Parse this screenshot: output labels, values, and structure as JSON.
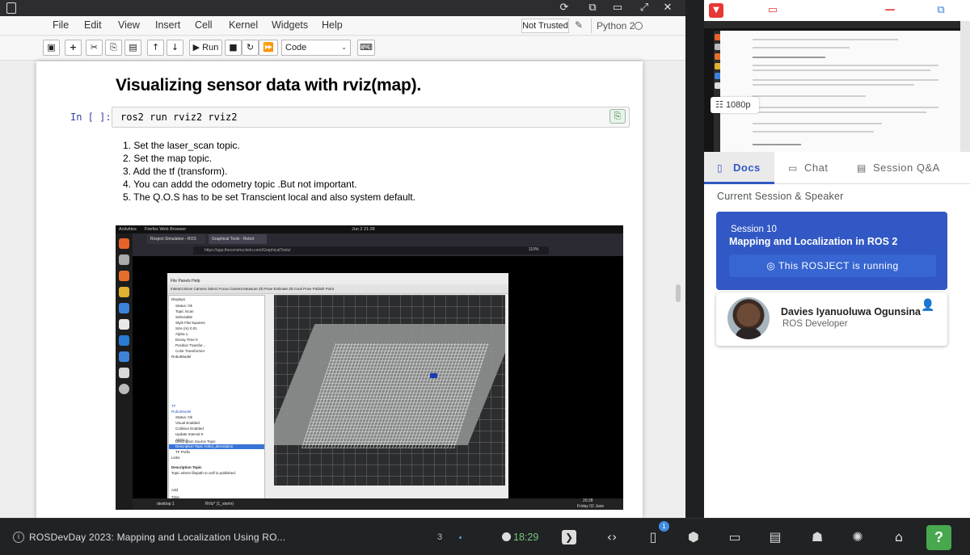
{
  "jupyter": {
    "menu": [
      "File",
      "Edit",
      "View",
      "Insert",
      "Cell",
      "Kernel",
      "Widgets",
      "Help"
    ],
    "trust_label": "Not Trusted",
    "kernel_label": "Python 2",
    "toolbar": {
      "run_label": "Run",
      "cell_type": "Code"
    },
    "heading": "Visualizing sensor data with rviz(map).",
    "prompt": "In [ ]:",
    "code": "ros2 run rviz2 rviz2",
    "steps": [
      "1. Set the laser_scan topic.",
      "2. Set the map topic.",
      "3. Add the tf (transform).",
      "4. You can addd the odometry topic .But not important.",
      "5. The Q.O.S has to be set Transcient local and also system default."
    ]
  },
  "embedded": {
    "activities": "Activities",
    "app_name": "Firefox Web Browser",
    "clock": "Jun 2  21:28",
    "tab1": "Rosject Simulation - ROS",
    "tab2": "Graphical Tools - Robot",
    "url": "https://app.theconstructsim.com/GraphicalTools/",
    "zoom": "110%",
    "rviz_menu": "File   Panels   Help",
    "rviz_tools": "Interact   Move Camera   Select   Focus Camera   Measure   2D Pose Estimate   2D Goal Pose   Publish Point",
    "rviz_rows": [
      "Displays",
      "Status: Ok",
      "Topic      /scan",
      "Selectable",
      "Style      Flat Squares",
      "Size (m)   0.01",
      "Alpha      1",
      "Decay Time 0",
      "Position Transfor...",
      "Color Transformer",
      "RobotModel",
      "TF",
      "RobotModel",
      "Status: Ok",
      "Visual Enabled",
      "Collision Enabled",
      "Update Interval  0",
      "Alpha  1",
      "Description Source  Topic",
      "Description Topic   /robot_description",
      "TF Prefix",
      "Links"
    ],
    "desc_title": "Description Topic",
    "desc_text": "Topic where filepath to urdf is published.",
    "add_label": "Add",
    "time_label": "Time",
    "desktop_label": "desktop 1",
    "rviz_task": "RViz* (1_xterm)",
    "time_display": "20:28",
    "date_display": "Friday 02 June"
  },
  "right": {
    "video_quality": "1080p",
    "tabs": [
      {
        "label": "Docs",
        "icon": "book-icon"
      },
      {
        "label": "Chat",
        "icon": "chat-icon"
      },
      {
        "label": "Session Q&A",
        "icon": "qa-icon"
      }
    ],
    "section_label": "Current Session & Speaker",
    "session_number": "Session 10",
    "session_title": "Mapping and Localization in ROS 2",
    "running_label": "This ROSJECT is running",
    "speaker_name": "Davies Iyanuoluwa Ogunsina",
    "speaker_role": "ROS Developer",
    "accent": "#3158c4"
  },
  "taskbar": {
    "title": "ROSDevDay 2023: Mapping and Localization Using RO...",
    "count": "3",
    "clock": "18:29",
    "badge": "1",
    "help": "?"
  }
}
